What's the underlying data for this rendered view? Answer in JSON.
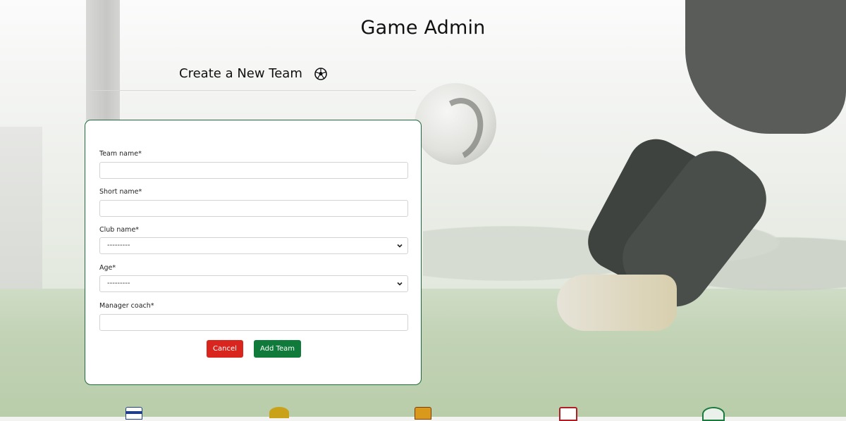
{
  "header": {
    "title": "Game Admin"
  },
  "section": {
    "title": "Create a New Team",
    "icon": "soccer-ball-icon"
  },
  "form": {
    "fields": [
      {
        "label": "Team name*",
        "type": "text",
        "value": ""
      },
      {
        "label": "Short name*",
        "type": "text",
        "value": ""
      },
      {
        "label": "Club name*",
        "type": "select",
        "value": "---------"
      },
      {
        "label": "Age*",
        "type": "select",
        "value": "---------"
      },
      {
        "label": "Manager coach*",
        "type": "text",
        "value": ""
      }
    ],
    "cancel_label": "Cancel",
    "add_label": "Add Team"
  },
  "footer": {
    "crests": [
      "england-crest-icon",
      "northern-ireland-crest-icon",
      "scotland-crest-icon",
      "wales-crest-icon",
      "ireland-crest-icon"
    ]
  },
  "colors": {
    "accent": "#0f7a3a",
    "danger": "#d8261f",
    "card_border": "#1e6b3b"
  }
}
